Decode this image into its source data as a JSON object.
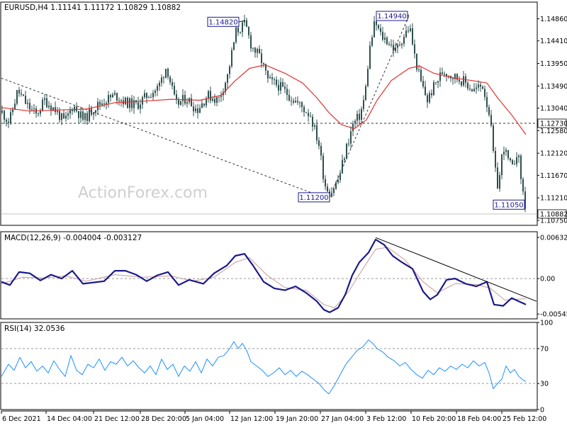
{
  "symbol_header": {
    "symbol": "EURUSD,H4",
    "open": "1.11141",
    "high": "1.11172",
    "low": "1.10829",
    "close": "1.10882"
  },
  "watermark": "ActionForex.com",
  "colors": {
    "candle": "#2f4f4f",
    "ma": "#e0322f",
    "macd": "#1a1a8c",
    "signal": "#c89a9a",
    "rsi": "#1e90ff",
    "trendline": "#000000",
    "grid_dash": "#9a9a9a",
    "price_box": "#1a1a8c"
  },
  "chart_data": [
    {
      "panel": "price",
      "type": "candlestick",
      "title": "EURUSD,H4",
      "y_ticks": [
        "1.14860",
        "1.14410",
        "1.13950",
        "1.13490",
        "1.13040",
        "1.12580",
        "1.12120",
        "1.11670",
        "1.11210",
        "1.10750"
      ],
      "ylim": [
        1.1065,
        1.152
      ],
      "current_price": "1.10882",
      "horizontal_level": "1.12730",
      "moving_average": "red line",
      "annotations": [
        {
          "label": "1.14820",
          "price": 1.1482,
          "date": "12 Jan"
        },
        {
          "label": "1.14940",
          "price": 1.1494,
          "date": "3 Feb"
        },
        {
          "label": "1.11200",
          "price": 1.112,
          "date": "27 Jan"
        },
        {
          "label": "1.11050",
          "price": 1.1105,
          "date": "24 Feb"
        }
      ],
      "price_path": [
        [
          0,
          1.1295
        ],
        [
          10,
          1.1275
        ],
        [
          22,
          1.134
        ],
        [
          35,
          1.131
        ],
        [
          48,
          1.129
        ],
        [
          60,
          1.132
        ],
        [
          75,
          1.13
        ],
        [
          88,
          1.1275
        ],
        [
          100,
          1.131
        ],
        [
          115,
          1.128
        ],
        [
          130,
          1.1305
        ],
        [
          145,
          1.132
        ],
        [
          160,
          1.133
        ],
        [
          175,
          1.1315
        ],
        [
          190,
          1.131
        ],
        [
          205,
          1.133
        ],
        [
          220,
          1.1345
        ],
        [
          232,
          1.139
        ],
        [
          245,
          1.131
        ],
        [
          260,
          1.1325
        ],
        [
          275,
          1.13
        ],
        [
          290,
          1.133
        ],
        [
          305,
          1.132
        ],
        [
          318,
          1.137
        ],
        [
          330,
          1.146
        ],
        [
          343,
          1.1475
        ],
        [
          352,
          1.143
        ],
        [
          365,
          1.1405
        ],
        [
          375,
          1.136
        ],
        [
          390,
          1.135
        ],
        [
          405,
          1.133
        ],
        [
          420,
          1.131
        ],
        [
          435,
          1.129
        ],
        [
          447,
          1.123
        ],
        [
          455,
          1.115
        ],
        [
          463,
          1.113
        ],
        [
          475,
          1.116
        ],
        [
          485,
          1.122
        ],
        [
          495,
          1.127
        ],
        [
          505,
          1.129
        ],
        [
          512,
          1.133
        ],
        [
          518,
          1.142
        ],
        [
          526,
          1.148
        ],
        [
          535,
          1.145
        ],
        [
          545,
          1.144
        ],
        [
          555,
          1.142
        ],
        [
          566,
          1.145
        ],
        [
          575,
          1.147
        ],
        [
          582,
          1.141
        ],
        [
          590,
          1.136
        ],
        [
          600,
          1.132
        ],
        [
          610,
          1.135
        ],
        [
          622,
          1.138
        ],
        [
          635,
          1.137
        ],
        [
          650,
          1.136
        ],
        [
          665,
          1.134
        ],
        [
          678,
          1.135
        ],
        [
          688,
          1.129
        ],
        [
          695,
          1.118
        ],
        [
          700,
          1.114
        ],
        [
          707,
          1.123
        ],
        [
          713,
          1.12
        ],
        [
          720,
          1.118
        ],
        [
          727,
          1.122
        ],
        [
          734,
          1.114
        ],
        [
          740,
          1.1088
        ]
      ],
      "ma_path": [
        [
          0,
          1.1305
        ],
        [
          40,
          1.1298
        ],
        [
          80,
          1.13
        ],
        [
          120,
          1.1302
        ],
        [
          160,
          1.1315
        ],
        [
          200,
          1.1318
        ],
        [
          240,
          1.1322
        ],
        [
          280,
          1.132
        ],
        [
          310,
          1.133
        ],
        [
          330,
          1.136
        ],
        [
          350,
          1.1385
        ],
        [
          372,
          1.1392
        ],
        [
          400,
          1.1375
        ],
        [
          425,
          1.1355
        ],
        [
          445,
          1.1325
        ],
        [
          462,
          1.1295
        ],
        [
          480,
          1.127
        ],
        [
          498,
          1.1262
        ],
        [
          515,
          1.128
        ],
        [
          530,
          1.132
        ],
        [
          550,
          1.136
        ],
        [
          575,
          1.1385
        ],
        [
          590,
          1.139
        ],
        [
          610,
          1.1375
        ],
        [
          640,
          1.1365
        ],
        [
          665,
          1.136
        ],
        [
          685,
          1.1355
        ],
        [
          700,
          1.1325
        ],
        [
          720,
          1.129
        ],
        [
          740,
          1.125
        ]
      ]
    },
    {
      "panel": "macd",
      "type": "line",
      "title": "MACD(12,26,9) -0.004004 -0.003127",
      "y_ticks": [
        "0.00632",
        "0.00",
        "-0.005455"
      ],
      "ylim": [
        -0.0062,
        0.0072
      ],
      "macd_path": [
        [
          0,
          -0.0005
        ],
        [
          12,
          -0.001
        ],
        [
          25,
          0.001
        ],
        [
          40,
          0.0008
        ],
        [
          55,
          -0.0003
        ],
        [
          70,
          0.0006
        ],
        [
          85,
          0.0
        ],
        [
          100,
          0.0012
        ],
        [
          115,
          -0.0008
        ],
        [
          130,
          -0.0006
        ],
        [
          145,
          -0.0004
        ],
        [
          160,
          0.0012
        ],
        [
          175,
          0.0012
        ],
        [
          190,
          0.0006
        ],
        [
          205,
          -0.0004
        ],
        [
          220,
          0.0005
        ],
        [
          235,
          0.001
        ],
        [
          250,
          -0.001
        ],
        [
          265,
          -0.0002
        ],
        [
          285,
          -0.0008
        ],
        [
          300,
          0.0008
        ],
        [
          318,
          0.002
        ],
        [
          330,
          0.0035
        ],
        [
          343,
          0.0038
        ],
        [
          355,
          0.002
        ],
        [
          370,
          -0.0005
        ],
        [
          385,
          -0.0015
        ],
        [
          400,
          -0.0018
        ],
        [
          415,
          -0.0012
        ],
        [
          430,
          -0.0022
        ],
        [
          445,
          -0.0035
        ],
        [
          455,
          -0.0048
        ],
        [
          463,
          -0.0052
        ],
        [
          475,
          -0.0045
        ],
        [
          485,
          -0.0025
        ],
        [
          495,
          0.0005
        ],
        [
          505,
          0.0025
        ],
        [
          518,
          0.004
        ],
        [
          528,
          0.006
        ],
        [
          540,
          0.0052
        ],
        [
          552,
          0.0035
        ],
        [
          565,
          0.0025
        ],
        [
          580,
          0.0015
        ],
        [
          595,
          -0.002
        ],
        [
          605,
          -0.0032
        ],
        [
          615,
          -0.0025
        ],
        [
          628,
          -0.0002
        ],
        [
          640,
          0.0
        ],
        [
          655,
          -0.0008
        ],
        [
          670,
          -0.0012
        ],
        [
          685,
          -0.0005
        ],
        [
          695,
          -0.004
        ],
        [
          708,
          -0.0042
        ],
        [
          720,
          -0.003
        ],
        [
          730,
          -0.0035
        ],
        [
          740,
          -0.004
        ]
      ],
      "signal_path": [
        [
          0,
          -0.0008
        ],
        [
          30,
          0.0002
        ],
        [
          60,
          0.0001
        ],
        [
          90,
          0.0004
        ],
        [
          120,
          -0.0004
        ],
        [
          160,
          0.0006
        ],
        [
          200,
          0.0002
        ],
        [
          240,
          0.0004
        ],
        [
          270,
          -0.0004
        ],
        [
          300,
          0.0002
        ],
        [
          330,
          0.0025
        ],
        [
          350,
          0.0032
        ],
        [
          375,
          0.0005
        ],
        [
          400,
          -0.0014
        ],
        [
          430,
          -0.0018
        ],
        [
          455,
          -0.004
        ],
        [
          470,
          -0.0045
        ],
        [
          490,
          -0.002
        ],
        [
          510,
          0.0015
        ],
        [
          528,
          0.0045
        ],
        [
          545,
          0.0048
        ],
        [
          570,
          0.0028
        ],
        [
          595,
          -0.0005
        ],
        [
          615,
          -0.0022
        ],
        [
          640,
          -0.0008
        ],
        [
          670,
          -0.0009
        ],
        [
          690,
          -0.0015
        ],
        [
          710,
          -0.0033
        ],
        [
          740,
          -0.0031
        ]
      ],
      "trendline": [
        [
          528,
          0.0063
        ],
        [
          755,
          -0.0035
        ]
      ]
    },
    {
      "panel": "rsi",
      "type": "line",
      "title": "RSI(14) 32.0536",
      "y_ticks": [
        "100",
        "70",
        "30",
        "0"
      ],
      "ylim": [
        0,
        100
      ],
      "levels": [
        70,
        30
      ],
      "rsi_path": [
        [
          0,
          38
        ],
        [
          10,
          52
        ],
        [
          18,
          45
        ],
        [
          26,
          60
        ],
        [
          34,
          48
        ],
        [
          42,
          55
        ],
        [
          50,
          44
        ],
        [
          58,
          50
        ],
        [
          66,
          42
        ],
        [
          74,
          56
        ],
        [
          82,
          46
        ],
        [
          90,
          38
        ],
        [
          98,
          62
        ],
        [
          106,
          45
        ],
        [
          114,
          40
        ],
        [
          122,
          52
        ],
        [
          130,
          48
        ],
        [
          138,
          58
        ],
        [
          146,
          45
        ],
        [
          154,
          55
        ],
        [
          162,
          52
        ],
        [
          170,
          60
        ],
        [
          178,
          50
        ],
        [
          186,
          56
        ],
        [
          194,
          48
        ],
        [
          202,
          42
        ],
        [
          210,
          50
        ],
        [
          218,
          40
        ],
        [
          226,
          58
        ],
        [
          234,
          46
        ],
        [
          242,
          52
        ],
        [
          250,
          38
        ],
        [
          258,
          50
        ],
        [
          266,
          44
        ],
        [
          274,
          55
        ],
        [
          282,
          42
        ],
        [
          290,
          58
        ],
        [
          298,
          50
        ],
        [
          306,
          60
        ],
        [
          314,
          62
        ],
        [
          322,
          70
        ],
        [
          328,
          78
        ],
        [
          334,
          70
        ],
        [
          340,
          76
        ],
        [
          346,
          68
        ],
        [
          352,
          55
        ],
        [
          360,
          50
        ],
        [
          368,
          45
        ],
        [
          376,
          38
        ],
        [
          384,
          42
        ],
        [
          392,
          48
        ],
        [
          400,
          40
        ],
        [
          408,
          45
        ],
        [
          416,
          38
        ],
        [
          424,
          44
        ],
        [
          432,
          40
        ],
        [
          440,
          35
        ],
        [
          448,
          30
        ],
        [
          456,
          22
        ],
        [
          462,
          18
        ],
        [
          470,
          28
        ],
        [
          478,
          40
        ],
        [
          486,
          52
        ],
        [
          494,
          60
        ],
        [
          502,
          68
        ],
        [
          510,
          72
        ],
        [
          518,
          80
        ],
        [
          524,
          76
        ],
        [
          530,
          70
        ],
        [
          538,
          66
        ],
        [
          546,
          60
        ],
        [
          554,
          56
        ],
        [
          562,
          50
        ],
        [
          570,
          54
        ],
        [
          578,
          46
        ],
        [
          586,
          40
        ],
        [
          594,
          36
        ],
        [
          602,
          45
        ],
        [
          610,
          40
        ],
        [
          618,
          48
        ],
        [
          626,
          44
        ],
        [
          634,
          50
        ],
        [
          642,
          46
        ],
        [
          650,
          52
        ],
        [
          658,
          48
        ],
        [
          666,
          56
        ],
        [
          674,
          50
        ],
        [
          682,
          54
        ],
        [
          688,
          42
        ],
        [
          694,
          24
        ],
        [
          700,
          30
        ],
        [
          706,
          35
        ],
        [
          712,
          50
        ],
        [
          718,
          42
        ],
        [
          724,
          46
        ],
        [
          730,
          38
        ],
        [
          736,
          34
        ],
        [
          740,
          32
        ]
      ]
    }
  ],
  "x_axis": {
    "labels": [
      {
        "text": "6 Dec 2021",
        "pos": 0
      },
      {
        "text": "14 Dec 04:00",
        "pos": 63
      },
      {
        "text": "21 Dec 12:00",
        "pos": 130
      },
      {
        "text": "28 Dec 20:00",
        "pos": 196
      },
      {
        "text": "5 Jan 04:00",
        "pos": 259
      },
      {
        "text": "12 Jan 12:00",
        "pos": 322
      },
      {
        "text": "19 Jan 20:00",
        "pos": 386
      },
      {
        "text": "27 Jan 04:00",
        "pos": 450
      },
      {
        "text": "3 Feb 12:00",
        "pos": 514
      },
      {
        "text": "10 Feb 20:00",
        "pos": 578
      },
      {
        "text": "18 Feb 04:00",
        "pos": 642
      },
      {
        "text": "25 Feb 12:00",
        "pos": 706
      }
    ]
  }
}
